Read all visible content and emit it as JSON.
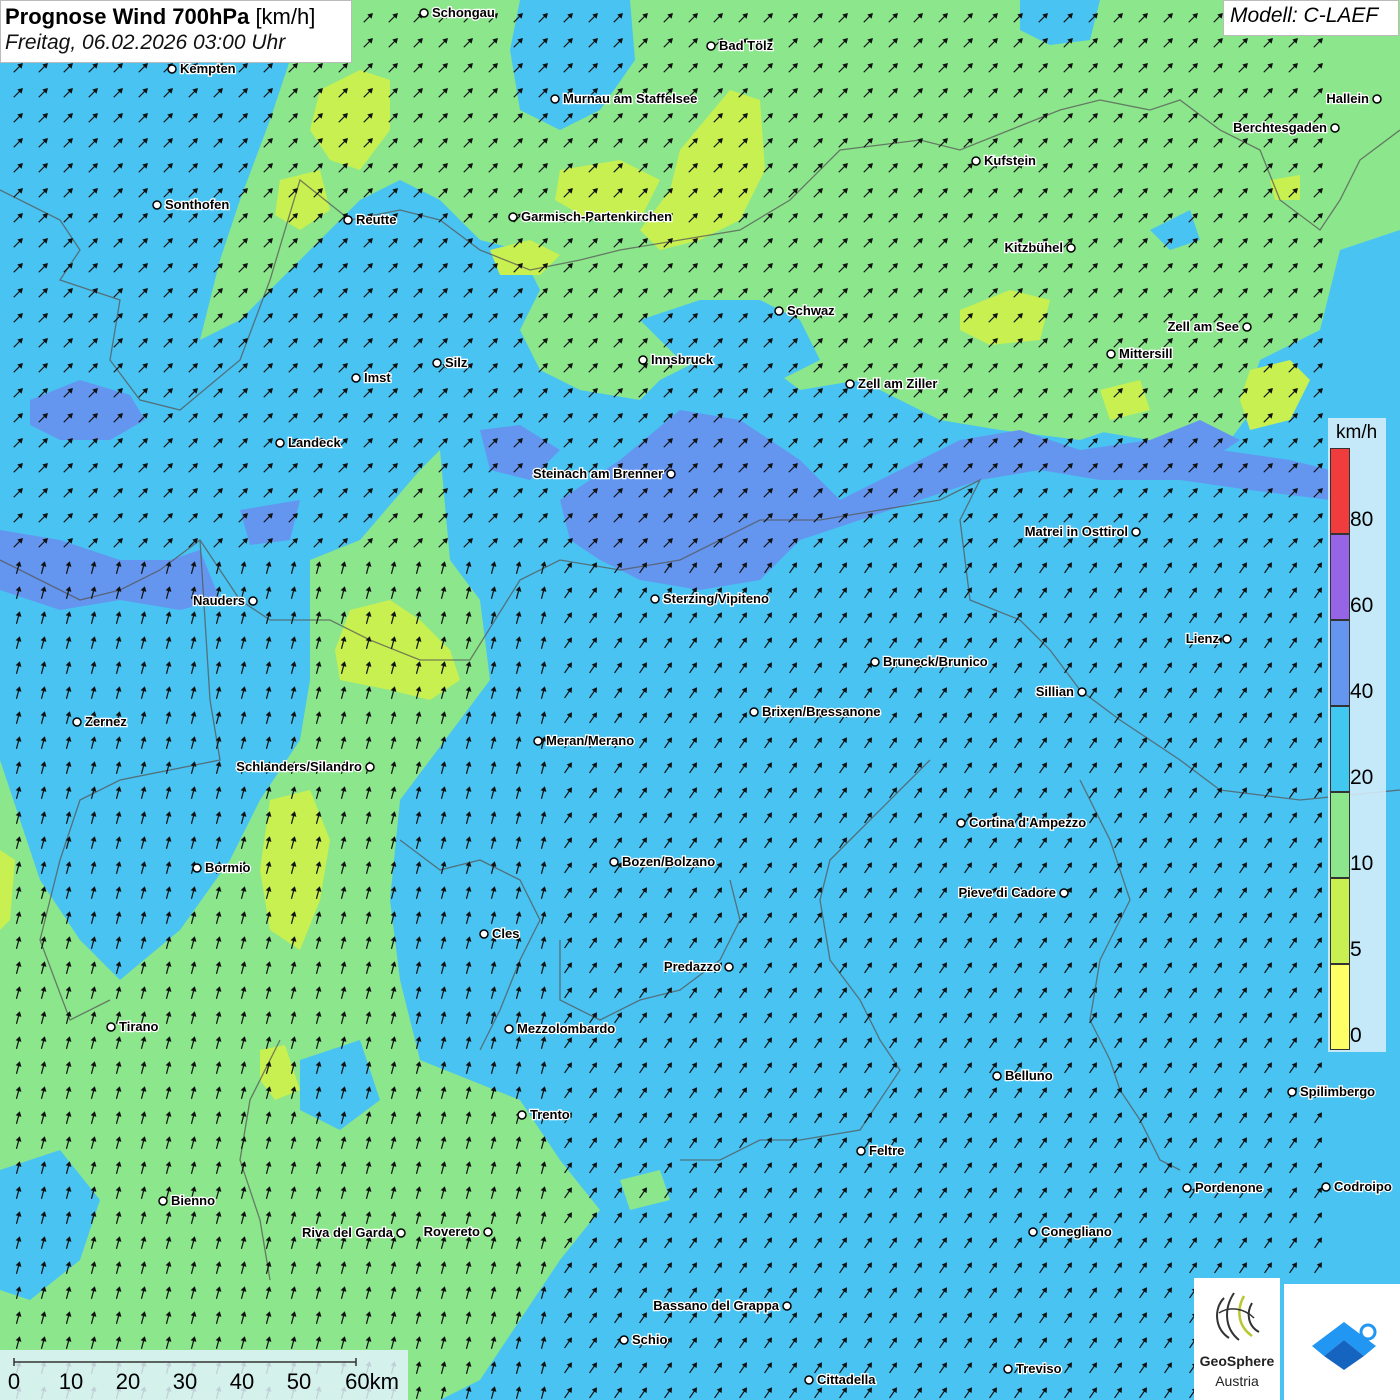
{
  "header": {
    "title_bold": "Prognose Wind 700hPa",
    "title_unit": "[km/h]",
    "subtitle": "Freitag, 06.02.2026 03:00 Uhr",
    "model": "Modell: C-LAEF"
  },
  "legend": {
    "unit": "km/h",
    "classes": [
      {
        "label": "0",
        "color": "#ffff66"
      },
      {
        "label": "5",
        "color": "#c8f050"
      },
      {
        "label": "10",
        "color": "#8ce68c"
      },
      {
        "label": "20",
        "color": "#40c8f0"
      },
      {
        "label": "40",
        "color": "#6496f0"
      },
      {
        "label": "60",
        "color": "#9664e6"
      },
      {
        "label": "80",
        "color": "#f03c3c"
      }
    ]
  },
  "scale_bar": {
    "labels": [
      "0",
      "10",
      "20",
      "30",
      "40",
      "50",
      "60km"
    ]
  },
  "logo": {
    "name_line1": "GeoSphere",
    "name_line2": "Austria"
  },
  "cities": [
    {
      "name": "Schongau"
    },
    {
      "name": "Bad Tölz"
    },
    {
      "name": "Kempten"
    },
    {
      "name": "Murnau am Staffelsee"
    },
    {
      "name": "Hallein"
    },
    {
      "name": "Berchtesgaden"
    },
    {
      "name": "Kufstein"
    },
    {
      "name": "Sonthofen"
    },
    {
      "name": "Reutte"
    },
    {
      "name": "Garmisch-Partenkirchen"
    },
    {
      "name": "Kitzbühel"
    },
    {
      "name": "Schwaz"
    },
    {
      "name": "Zell am See"
    },
    {
      "name": "Mittersill"
    },
    {
      "name": "Innsbruck"
    },
    {
      "name": "Imst"
    },
    {
      "name": "Silz"
    },
    {
      "name": "Zell am Ziller"
    },
    {
      "name": "Landeck"
    },
    {
      "name": "Steinach am Brenner"
    },
    {
      "name": "Matrei in Osttirol"
    },
    {
      "name": "Nauders"
    },
    {
      "name": "Sterzing/Vipiteno"
    },
    {
      "name": "Lienz"
    },
    {
      "name": "Bruneck/Brunico"
    },
    {
      "name": "Sillian"
    },
    {
      "name": "Zernez"
    },
    {
      "name": "Brixen/Bressanone"
    },
    {
      "name": "Meran/Merano"
    },
    {
      "name": "Schlanders/Silandro"
    },
    {
      "name": "Cortina d'Ampezzo"
    },
    {
      "name": "Bormio"
    },
    {
      "name": "Bozen/Bolzano"
    },
    {
      "name": "Pieve di Cadore"
    },
    {
      "name": "Cles"
    },
    {
      "name": "Predazzo"
    },
    {
      "name": "Tirano"
    },
    {
      "name": "Mezzolombardo"
    },
    {
      "name": "Belluno"
    },
    {
      "name": "Spilimbergo"
    },
    {
      "name": "Trento"
    },
    {
      "name": "Feltre"
    },
    {
      "name": "Pordenone"
    },
    {
      "name": "Codroipo"
    },
    {
      "name": "Bienno"
    },
    {
      "name": "Riva del Garda"
    },
    {
      "name": "Rovereto"
    },
    {
      "name": "Conegliano"
    },
    {
      "name": "Bassano del Grappa"
    },
    {
      "name": "Schio"
    },
    {
      "name": "Treviso"
    },
    {
      "name": "Cittadella"
    }
  ]
}
